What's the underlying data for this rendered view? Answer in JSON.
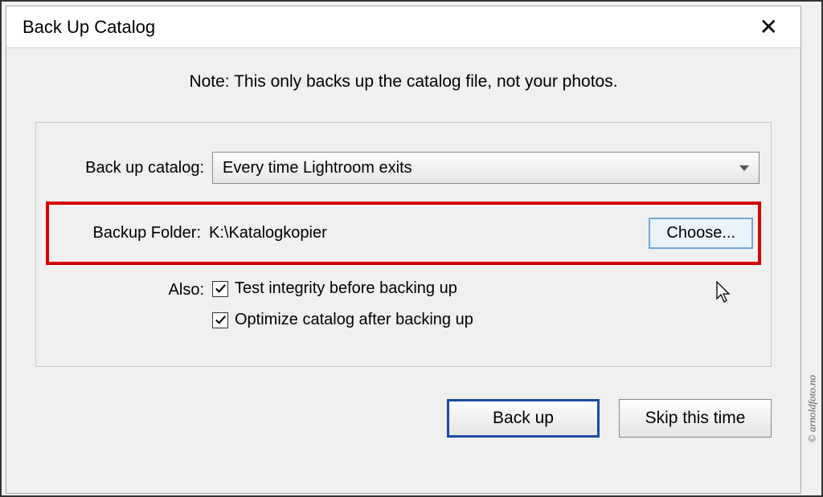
{
  "dialog": {
    "title": "Back Up Catalog",
    "close_symbol": "✕"
  },
  "note": "Note: This only backs up the catalog file, not your photos.",
  "labels": {
    "backup_catalog": "Back up catalog:",
    "backup_folder": "Backup Folder:",
    "also": "Also:"
  },
  "backup_catalog_dropdown": {
    "selected": "Every time Lightroom exits"
  },
  "backup_folder": {
    "path": "K:\\Katalogkopier",
    "choose_label": "Choose..."
  },
  "options": {
    "test_integrity": {
      "checked": true,
      "label": "Test integrity before backing up"
    },
    "optimize": {
      "checked": true,
      "label": "Optimize catalog after backing up"
    }
  },
  "buttons": {
    "backup": "Back up",
    "skip": "Skip this time"
  },
  "watermark": "© arnoldfoto.no"
}
